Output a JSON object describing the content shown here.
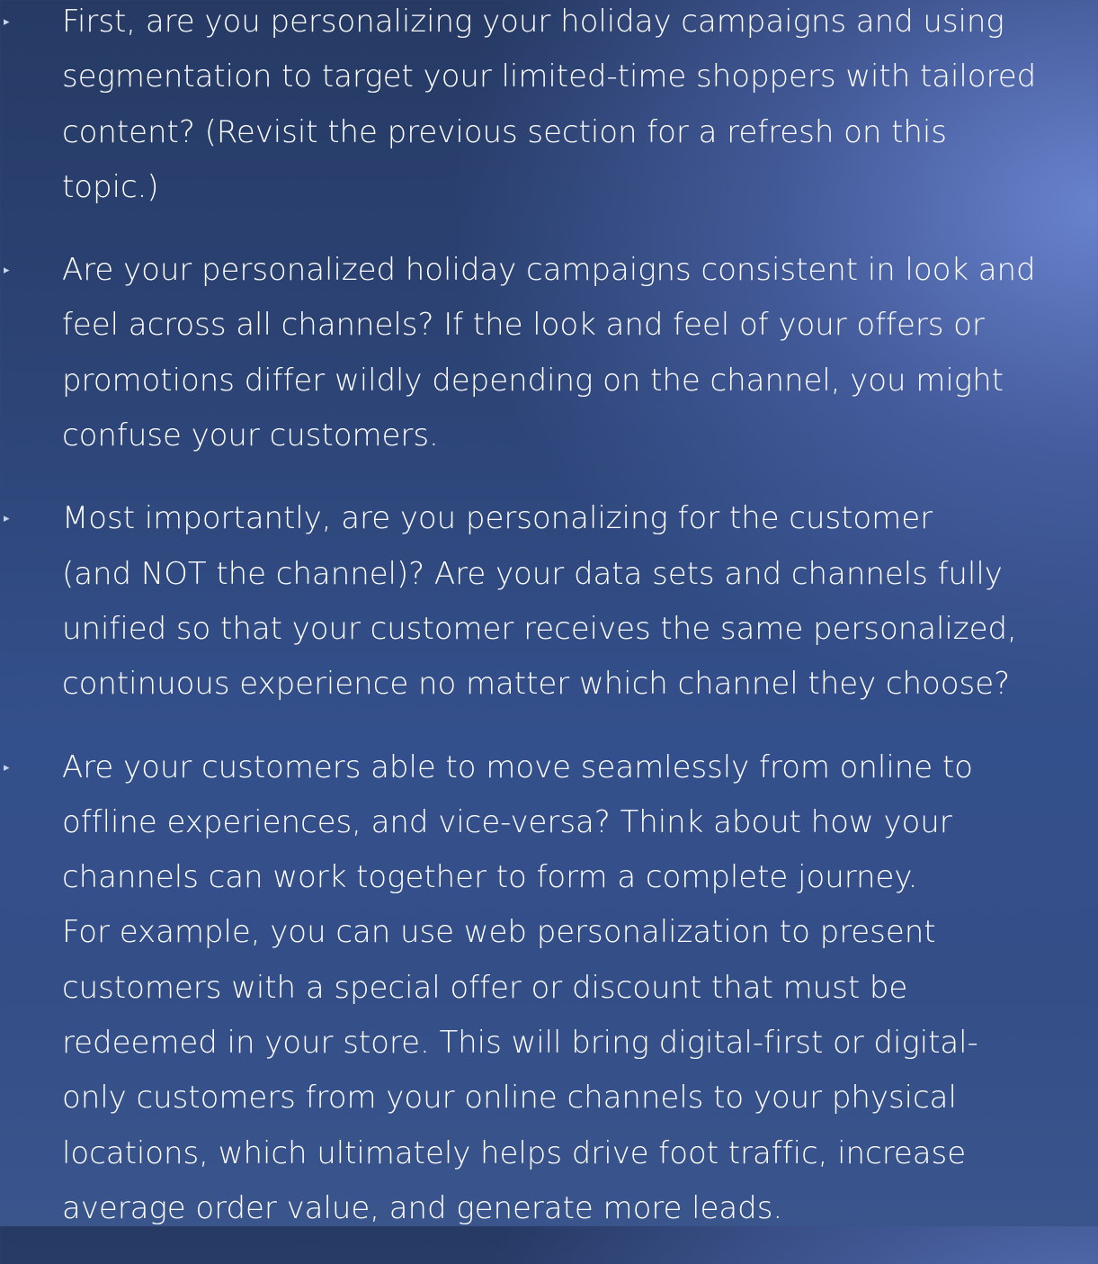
{
  "bullet_marker_glyph": "▸",
  "colors": {
    "text": "#ffffff",
    "bullet": "#c9d4ee",
    "background_dark": "#263a64",
    "background_light": "#6c86d2"
  },
  "bullets": [
    {
      "lines": [
        "First, are you personalizing your holiday campaigns and using",
        "segmentation to target your limited-time shoppers with tailored",
        "content? (Revisit the previous section for a refresh on this",
        "topic.)"
      ]
    },
    {
      "lines": [
        "Are your personalized holiday campaigns consistent in look and",
        "feel across all channels? If the look and feel of your offers or",
        "promotions differ wildly depending on the channel, you might",
        "confuse your customers."
      ]
    },
    {
      "lines": [
        "Most importantly, are you personalizing for the customer",
        "(and NOT the channel)? Are your data sets and channels fully",
        "unified so that your customer receives the same personalized,",
        "continuous experience no matter which channel they choose?"
      ]
    },
    {
      "lines": [
        "Are your customers able to move seamlessly from online to",
        "offline experiences, and vice-versa? Think about how your",
        "channels can work together to form a complete journey.",
        "For example, you can use web personalization to present",
        "customers with a special offer or discount that must be",
        "redeemed in your store. This will bring digital-first or digital-",
        "only customers from your online channels to your physical",
        "locations, which ultimately helps drive foot traffic, increase",
        "average order value, and generate more leads."
      ]
    }
  ]
}
